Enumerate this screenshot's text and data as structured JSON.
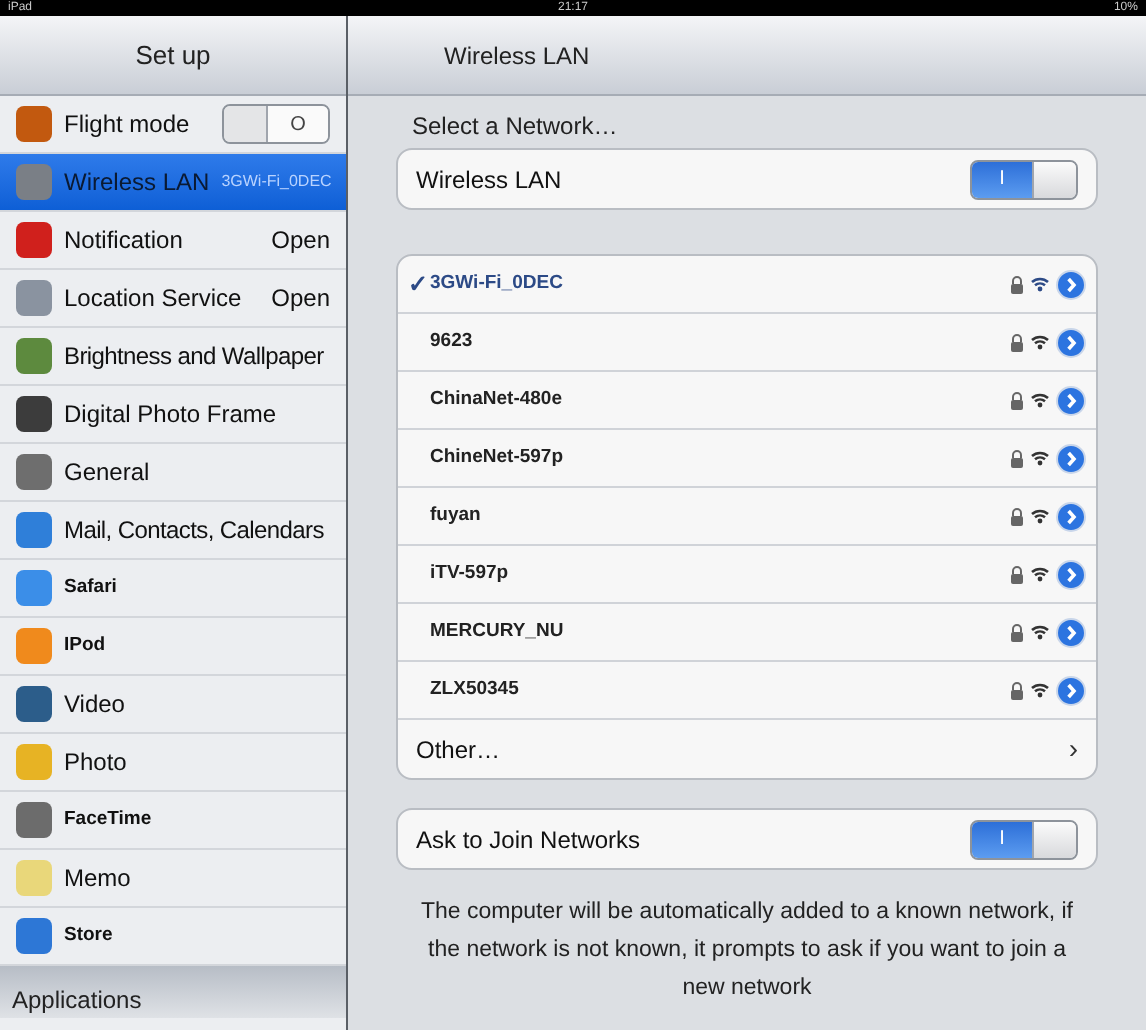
{
  "status_bar": {
    "device": "iPad",
    "time": "21:17",
    "battery": "10%"
  },
  "sidebar": {
    "title": "Set up",
    "items": [
      {
        "label": "Flight mode",
        "selected": false,
        "bold": false,
        "switch": {
          "on": false,
          "text": "O"
        }
      },
      {
        "label": "Wireless LAN",
        "selected": true,
        "bold": false,
        "value": "3GWi-Fi_0DEC"
      },
      {
        "label": "Notification",
        "selected": false,
        "bold": false,
        "value": "Open"
      },
      {
        "label": "Location Service",
        "selected": false,
        "bold": false,
        "value": "Open"
      },
      {
        "label": "Brightness and Wallpaper",
        "selected": false,
        "bold": false
      },
      {
        "label": "Digital Photo Frame",
        "selected": false,
        "bold": false
      },
      {
        "label": "General",
        "selected": false,
        "bold": false
      },
      {
        "label": "Mail, Contacts, Calendars",
        "selected": false,
        "bold": false
      },
      {
        "label": "Safari",
        "selected": false,
        "bold": true
      },
      {
        "label": "IPod",
        "selected": false,
        "bold": true
      },
      {
        "label": "Video",
        "selected": false,
        "bold": false
      },
      {
        "label": "Photo",
        "selected": false,
        "bold": false
      },
      {
        "label": "FaceTime",
        "selected": false,
        "bold": true
      },
      {
        "label": "Memo",
        "selected": false,
        "bold": false
      },
      {
        "label": "Store",
        "selected": false,
        "bold": true
      }
    ],
    "section": "Applications"
  },
  "detail": {
    "title": "Wireless LAN",
    "select_label": "Select a Network…",
    "wifi_row": {
      "label": "Wireless LAN",
      "switch": {
        "on": true,
        "text": "I"
      }
    },
    "networks": [
      {
        "name": "3GWi-Fi_0DEC",
        "selected": true,
        "check": "✓"
      },
      {
        "name": "9623",
        "selected": false
      },
      {
        "name": "ChinaNet-480e",
        "selected": false
      },
      {
        "name": "ChineNet-597p",
        "selected": false
      },
      {
        "name": "fuyan",
        "selected": false
      },
      {
        "name": "iTV-597p",
        "selected": false
      },
      {
        "name": "MERCURY_NU",
        "selected": false
      },
      {
        "name": "ZLX50345",
        "selected": false
      }
    ],
    "other": {
      "label": "Other…",
      "chevron": "›"
    },
    "ask_row": {
      "label": "Ask to Join Networks",
      "switch": {
        "on": true,
        "text": "I"
      }
    },
    "footnote": "The computer will be automatically added to a known network, if the network is not known, it prompts to ask if you want to join a new network"
  }
}
